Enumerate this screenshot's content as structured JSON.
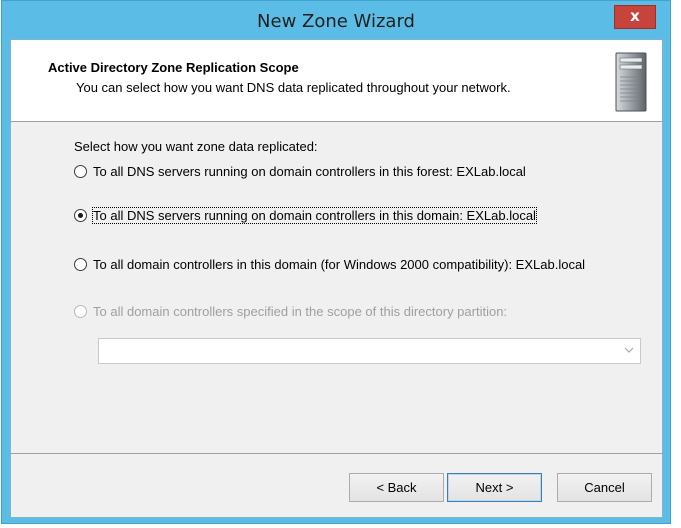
{
  "window": {
    "title": "New Zone Wizard",
    "close_label": "x"
  },
  "header": {
    "title": "Active Directory Zone Replication Scope",
    "subtitle": "You can select how you want DNS data replicated throughout your network."
  },
  "body": {
    "prompt": "Select how you want zone data replicated:",
    "options": [
      {
        "label": "To all DNS servers running on domain controllers in this forest: EXLab.local",
        "checked": false,
        "disabled": false
      },
      {
        "label": "To all DNS servers running on domain controllers in this domain: EXLab.local",
        "checked": true,
        "disabled": false
      },
      {
        "label": "To all domain controllers in this domain (for Windows 2000 compatibility): EXLab.local",
        "checked": false,
        "disabled": false
      },
      {
        "label": "To all domain controllers specified in the scope of this directory partition:",
        "checked": false,
        "disabled": true
      }
    ],
    "partition_select": {
      "value": ""
    }
  },
  "buttons": {
    "back": "< Back",
    "next": "Next >",
    "cancel": "Cancel"
  },
  "icons": {
    "close": "close-icon",
    "server": "server-icon",
    "dropdown": "chevron-down-icon"
  }
}
